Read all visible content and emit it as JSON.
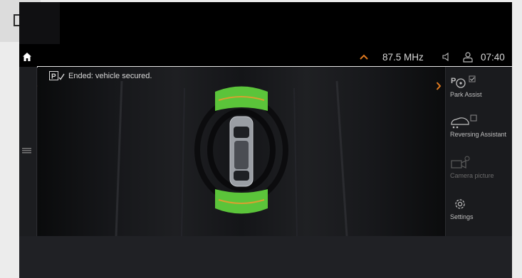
{
  "status_bar": {
    "radio_frequency": "87.5 MHz",
    "clock": "07:40"
  },
  "camera_view": {
    "status_message": "Ended: vehicle secured."
  },
  "side_menu": {
    "items": [
      {
        "label": "Park Assist",
        "icon": "park-assist-icon",
        "state": "active"
      },
      {
        "label": "Reversing Assistant",
        "icon": "reversing-assistant-icon",
        "state": "active"
      },
      {
        "label": "Camera picture",
        "icon": "camera-picture-icon",
        "state": "disabled"
      },
      {
        "label": "Settings",
        "icon": "settings-gear-icon",
        "state": "active"
      }
    ]
  },
  "colors": {
    "proximity_green": "#5bc43a",
    "proximity_amber": "#d9a030",
    "status_text": "#d8d8d8",
    "nav_arrow": "#e07a20"
  }
}
